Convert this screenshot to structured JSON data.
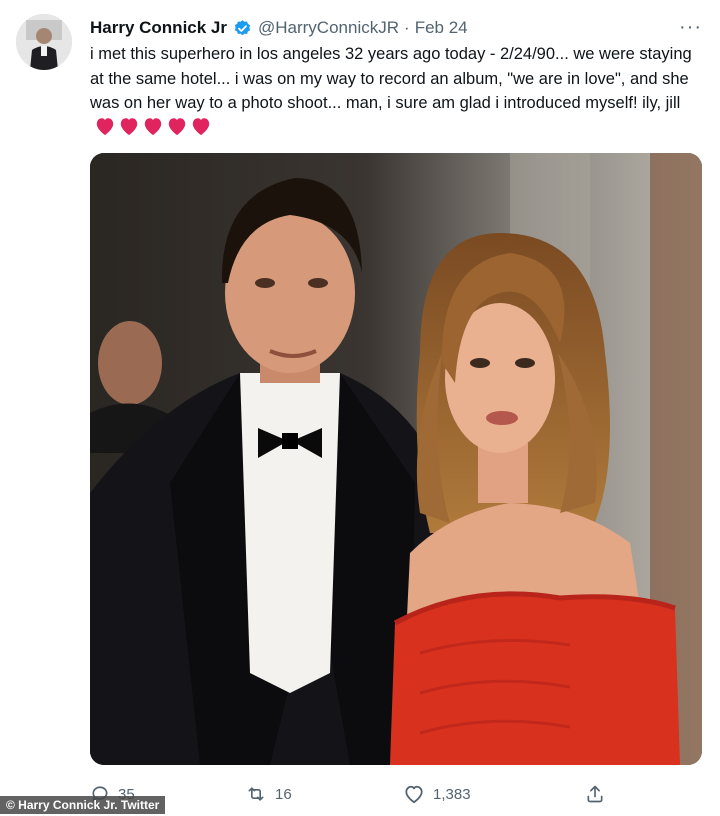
{
  "tweet": {
    "author_name": "Harry Connick Jr",
    "handle": "@HarryConnickJR",
    "separator": "·",
    "date": "Feb 24",
    "more": "···",
    "text": "i met this superhero in los angeles 32 years ago today - 2/24/90... we were staying at the same hotel... i was on my way to record an album, \"we are in love\", and she was on her way to a photo shoot... man, i sure am glad i introduced myself! ily, jill",
    "heart_count": 5
  },
  "actions": {
    "replies": "35",
    "retweets": "16",
    "likes": "1,383"
  },
  "credit": "© Harry Connick Jr. Twitter",
  "colors": {
    "verified": "#1d9bf0",
    "heart": "#e0245e",
    "muted_text": "#536471",
    "dress": "#d8321f"
  },
  "icons": [
    "verified-badge-icon",
    "more-icon",
    "reply-icon",
    "retweet-icon",
    "like-icon",
    "share-icon",
    "red-heart-icon"
  ]
}
